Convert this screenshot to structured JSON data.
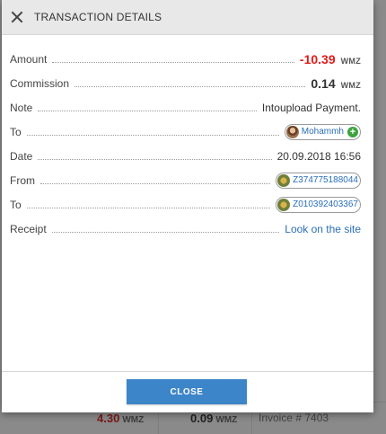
{
  "modal": {
    "title": "TRANSACTION DETAILS",
    "close_button": "CLOSE",
    "rows": {
      "amount": {
        "label": "Amount",
        "value": "-10.39",
        "unit": "WMZ"
      },
      "commission": {
        "label": "Commission",
        "value": "0.14",
        "unit": "WMZ"
      },
      "note": {
        "label": "Note",
        "value": "Intoupload Payment."
      },
      "to_user": {
        "label": "To",
        "name": "Mohammh"
      },
      "date": {
        "label": "Date",
        "value": "20.09.2018 16:56"
      },
      "from_purse": {
        "label": "From",
        "value": "Z374775188044"
      },
      "to_purse": {
        "label": "To",
        "value": "Z010392403367"
      },
      "receipt": {
        "label": "Receipt",
        "link": "Look on the site"
      }
    }
  },
  "background": {
    "amount": "4.30",
    "amount_unit": "WMZ",
    "commission": "0.09",
    "commission_unit": "WMZ",
    "invoice": "Invoice # 7403"
  },
  "colors": {
    "negative": "#e21b1b",
    "link": "#2a6fb9",
    "button": "#3d85c9",
    "header": "#e8e8e8"
  }
}
